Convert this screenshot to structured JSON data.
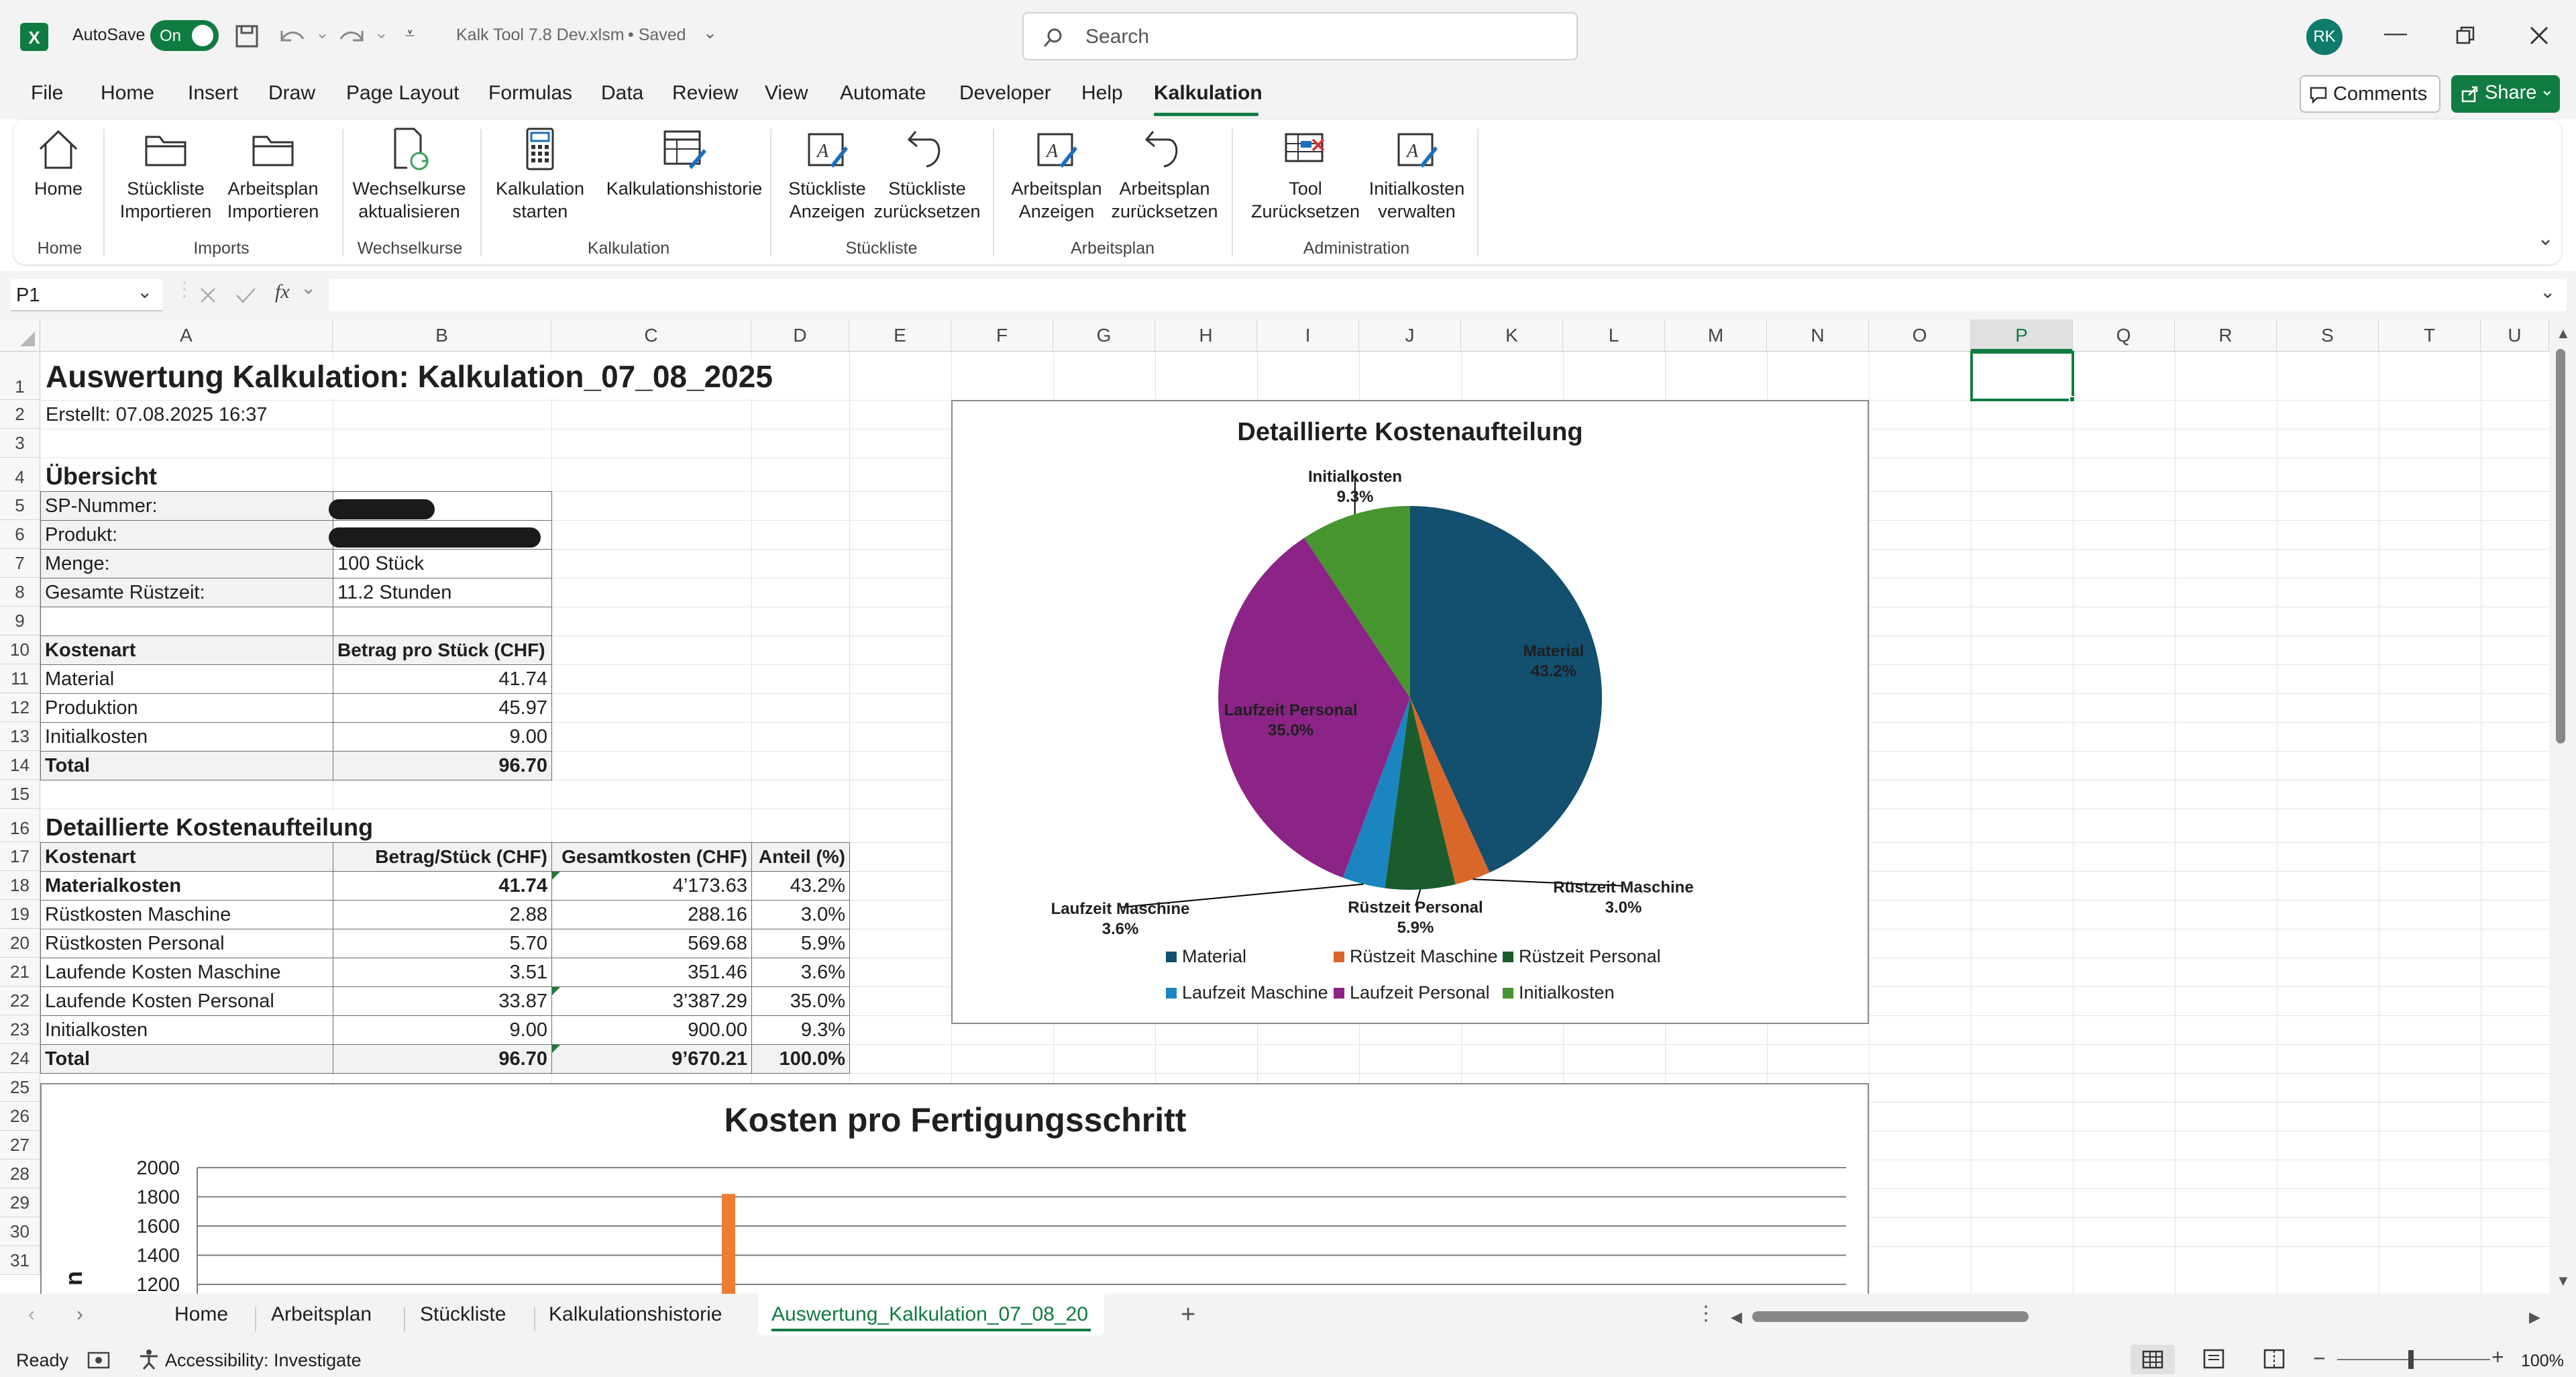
{
  "window": {
    "app_icon": "excel-icon",
    "autosave_label": "AutoSave",
    "autosave_state": "On",
    "filename": "Kalk Tool 7.8 Dev.xlsm",
    "saved_status": "• Saved",
    "search_placeholder": "Search",
    "user_initials": "RK"
  },
  "menu": {
    "items": [
      "File",
      "Home",
      "Insert",
      "Draw",
      "Page Layout",
      "Formulas",
      "Data",
      "Review",
      "View",
      "Automate",
      "Developer",
      "Help",
      "Kalkulation"
    ],
    "active": "Kalkulation",
    "comments_label": "Comments",
    "share_label": "Share"
  },
  "ribbon": {
    "buttons": [
      {
        "line1": "Home",
        "line2": "",
        "icon": "home-icon"
      },
      {
        "line1": "Stückliste",
        "line2": "Importieren",
        "icon": "folder-icon"
      },
      {
        "line1": "Arbeitsplan",
        "line2": "Importieren",
        "icon": "folder-icon"
      },
      {
        "line1": "Wechselkurse",
        "line2": "aktualisieren",
        "icon": "refresh-doc-icon"
      },
      {
        "line1": "Kalkulation",
        "line2": "starten",
        "icon": "calculator-icon"
      },
      {
        "line1": "Kalkulationshistorie",
        "line2": "",
        "icon": "table-edit-icon"
      },
      {
        "line1": "Stückliste",
        "line2": "Anzeigen",
        "icon": "edit-shape-icon"
      },
      {
        "line1": "Stückliste",
        "line2": "zurücksetzen",
        "icon": "undo-icon"
      },
      {
        "line1": "Arbeitsplan",
        "line2": "Anzeigen",
        "icon": "edit-shape-icon"
      },
      {
        "line1": "Arbeitsplan",
        "line2": "zurücksetzen",
        "icon": "undo-icon"
      },
      {
        "line1": "Tool",
        "line2": "Zurücksetzen",
        "icon": "table-delete-icon"
      },
      {
        "line1": "Initialkosten",
        "line2": "verwalten",
        "icon": "edit-shape-icon"
      }
    ],
    "groups": [
      "Home",
      "Imports",
      "Wechselkurse",
      "Kalkulation",
      "Stückliste",
      "Arbeitsplan",
      "Administration"
    ]
  },
  "formula_bar": {
    "name_box": "P1",
    "formula": ""
  },
  "columns": [
    "A",
    "B",
    "C",
    "D",
    "E",
    "F",
    "G",
    "H",
    "I",
    "J",
    "K",
    "L",
    "M",
    "N",
    "O",
    "P",
    "Q",
    "R",
    "S",
    "T",
    "U"
  ],
  "rows": [
    "1",
    "2",
    "3",
    "4",
    "5",
    "6",
    "7",
    "8",
    "9",
    "10",
    "11",
    "12",
    "13",
    "14",
    "15",
    "16",
    "17",
    "18",
    "19",
    "20",
    "21",
    "22",
    "23",
    "24",
    "25",
    "26",
    "27",
    "28",
    "29",
    "30",
    "31"
  ],
  "sheet": {
    "title": "Auswertung Kalkulation: Kalkulation_07_08_2025",
    "created": "Erstellt: 07.08.2025 16:37",
    "overview_heading": "Übersicht",
    "overview": [
      {
        "label": "SP-Nummer:",
        "value": ""
      },
      {
        "label": "Produkt:",
        "value": ""
      },
      {
        "label": "Menge:",
        "value": "100 Stück"
      },
      {
        "label": "Gesamte Rüstzeit:",
        "value": "11.2 Stunden"
      }
    ],
    "summary_header": [
      "Kostenart",
      "Betrag pro Stück (CHF)"
    ],
    "summary_rows": [
      [
        "Material",
        "41.74"
      ],
      [
        "Produktion",
        "45.97"
      ],
      [
        "Initialkosten",
        "9.00"
      ]
    ],
    "summary_total": [
      "Total",
      "96.70"
    ],
    "detail_heading": "Detaillierte Kostenaufteilung",
    "detail_header": [
      "Kostenart",
      "Betrag/Stück (CHF)",
      "Gesamtkosten (CHF)",
      "Anteil (%)"
    ],
    "detail_rows": [
      [
        "Materialkosten",
        "41.74",
        "4’173.63",
        "43.2%"
      ],
      [
        "Rüstkosten Maschine",
        "2.88",
        "288.16",
        "3.0%"
      ],
      [
        "Rüstkosten Personal",
        "5.70",
        "569.68",
        "5.9%"
      ],
      [
        "Laufende Kosten Maschine",
        "3.51",
        "351.46",
        "3.6%"
      ],
      [
        "Laufende Kosten Personal",
        "33.87",
        "3’387.29",
        "35.0%"
      ],
      [
        "Initialkosten",
        "9.00",
        "900.00",
        "9.3%"
      ]
    ],
    "detail_total": [
      "Total",
      "96.70",
      "9’670.21",
      "100.0%"
    ]
  },
  "chart_data": [
    {
      "type": "pie",
      "title": "Detaillierte Kostenaufteilung",
      "categories": [
        "Material",
        "Rüstzeit Maschine",
        "Rüstzeit Personal",
        "Laufzeit Maschine",
        "Laufzeit Personal",
        "Initialkosten"
      ],
      "values": [
        43.2,
        3.0,
        5.9,
        3.6,
        35.0,
        9.3
      ],
      "data_labels": [
        "43.2%",
        "3.0%",
        "5.9%",
        "3.6%",
        "35.0%",
        "9.3%"
      ],
      "colors": [
        "#134f6e",
        "#d9672a",
        "#1a5c2b",
        "#1b85c2",
        "#8b2486",
        "#46952f"
      ],
      "legend": "bottom"
    },
    {
      "type": "bar",
      "title": "Kosten pro Fertigungsschritt",
      "ylim": [
        0,
        2000
      ],
      "yticks": [
        "2000",
        "1800",
        "1600",
        "1400",
        "1200"
      ],
      "visible_bar_value": 1820,
      "bar_color": "#ed7d31",
      "ylabel_fragment": "n"
    }
  ],
  "tabs": {
    "items": [
      "Home",
      "Arbeitsplan",
      "Stückliste",
      "Kalkulationshistorie",
      "Auswertung_Kalkulation_07_08_20"
    ],
    "active": "Auswertung_Kalkulation_07_08_20"
  },
  "status": {
    "ready": "Ready",
    "accessibility": "Accessibility: Investigate",
    "zoom": "100%"
  }
}
